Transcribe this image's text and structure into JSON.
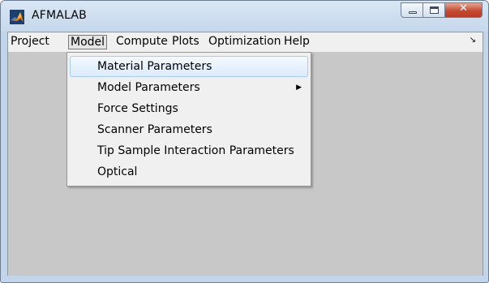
{
  "window": {
    "title": "AFMALAB",
    "controls": {
      "minimize": "minimize",
      "maximize": "maximize",
      "close": "close"
    },
    "close_glyph": "✕"
  },
  "menubar": {
    "items": [
      "Project",
      "Model",
      "Compute",
      "Plots",
      "Optimization",
      "Help"
    ],
    "open_item": "Model",
    "overflow_glyph": "↘"
  },
  "dropdown": {
    "items": [
      {
        "label": "Material Parameters",
        "highlighted": true
      },
      {
        "label": "Model Parameters",
        "submenu": true
      },
      {
        "label": "Force Settings"
      },
      {
        "label": "Scanner Parameters"
      },
      {
        "label": "Tip Sample Interaction Parameters"
      },
      {
        "label": "Optical"
      }
    ],
    "submenu_glyph": "▶"
  },
  "icons": {
    "app": "matlab-logo-icon"
  },
  "colors": {
    "canvas": "#c8c8c8",
    "menubar": "#f0f0f0",
    "titlebar": "#c6d8ec",
    "close": "#c44a33"
  }
}
